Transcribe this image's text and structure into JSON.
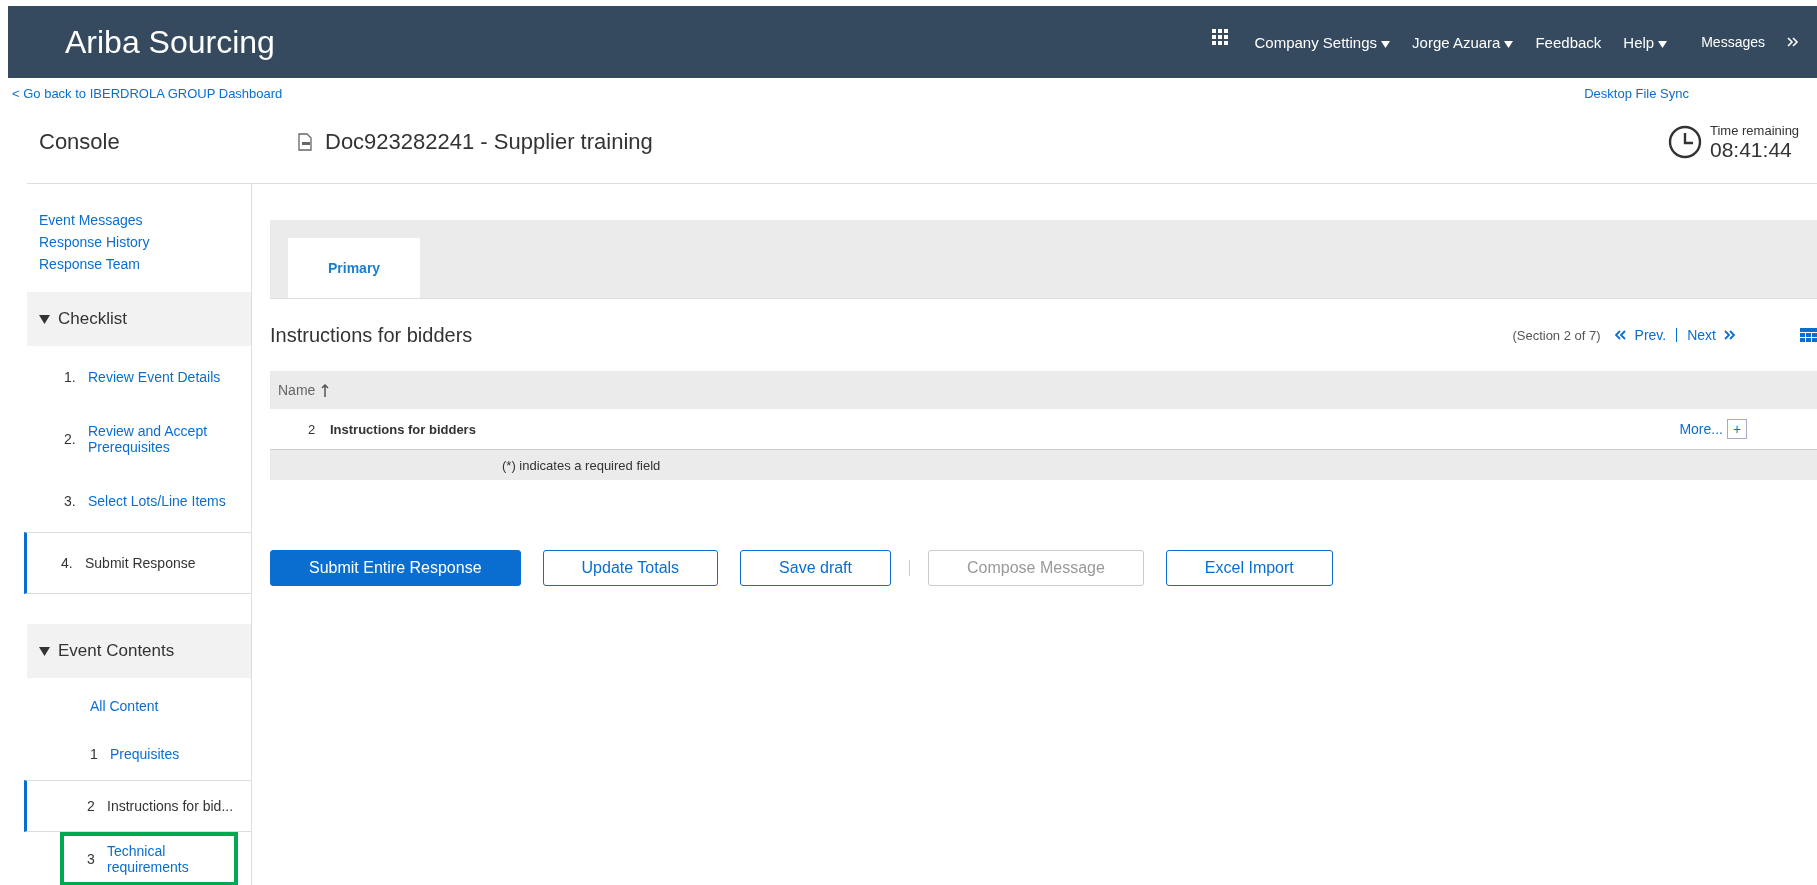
{
  "header": {
    "title": "Ariba Sourcing",
    "menus": [
      {
        "label": "Company Settings",
        "dropdown": true
      },
      {
        "label": "Jorge Azuara",
        "dropdown": true
      },
      {
        "label": "Feedback",
        "dropdown": false
      },
      {
        "label": "Help",
        "dropdown": true
      }
    ],
    "messages": "Messages"
  },
  "back_link": "< Go back to IBERDROLA GROUP Dashboard",
  "sync_link": "Desktop File Sync",
  "console_title": "Console",
  "document_title": "Doc923282241 - Supplier training",
  "timer": {
    "label": "Time remaining",
    "value": "08:41:44"
  },
  "sidebar": {
    "links": [
      "Event Messages",
      "Response History",
      "Response Team"
    ],
    "checklist": {
      "title": "Checklist",
      "expanded": true,
      "items": [
        {
          "number": "1.",
          "label": "Review Event Details",
          "selected": false
        },
        {
          "number": "2.",
          "label": "Review and Accept Prerequisites",
          "selected": false
        },
        {
          "number": "3.",
          "label": "Select Lots/Line Items",
          "selected": false
        },
        {
          "number": "4.",
          "label": "Submit Response",
          "selected": true
        }
      ]
    },
    "contents": {
      "title": "Event Contents",
      "expanded": true,
      "all": "All Content",
      "items": [
        {
          "number": "1",
          "label": "Prequisites",
          "selected": false,
          "highlighted": false
        },
        {
          "number": "2",
          "label": "Instructions for bid...",
          "selected": true,
          "highlighted": false
        },
        {
          "number": "3",
          "label": "Technical requirements",
          "selected": false,
          "highlighted": true
        }
      ]
    }
  },
  "tabs": [
    {
      "label": "Primary",
      "selected": true
    }
  ],
  "section": {
    "title": "Instructions for bidders",
    "position": "(Section 2 of 7)",
    "prev": "Prev.",
    "next": "Next"
  },
  "table": {
    "column": "Name",
    "rows": [
      {
        "number": "2",
        "name": "Instructions for bidders",
        "more": "More...",
        "add": "+"
      }
    ],
    "note": "(*) indicates a required field"
  },
  "buttons": [
    {
      "label": "Submit Entire Response",
      "kind": "primary",
      "disabled": false
    },
    {
      "label": "Update Totals",
      "kind": "secondary",
      "disabled": false
    },
    {
      "label": "Save draft",
      "kind": "secondary",
      "disabled": false
    },
    {
      "label": "Compose Message",
      "kind": "secondary",
      "disabled": true
    },
    {
      "label": "Excel Import",
      "kind": "secondary",
      "disabled": false
    }
  ]
}
